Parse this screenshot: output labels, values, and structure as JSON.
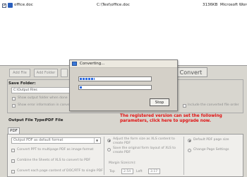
{
  "file_list": {
    "rows": [
      {
        "checked": true,
        "name": "office.doc",
        "path": "C:\\Test\\office.doc",
        "size": "3136KB",
        "type": "Microsoft Word"
      }
    ]
  },
  "toolbar": {
    "add_file": "Add File",
    "add_folder": "Add Folder",
    "convert": "Convert"
  },
  "save_folder": {
    "title": "Save Folder:",
    "path": "C:\\Output Files",
    "option_1": "Show output folder when done",
    "option_2": "Show error information in conversion",
    "include_order": "Include the converted file order"
  },
  "dialog": {
    "title": "Converting...",
    "progress_1": 0.21,
    "progress_2": 0.04,
    "stop_label": "Stop"
  },
  "registered_message": "The registered version can set the following parameters, click here to upgrade now.",
  "output": {
    "type_label": "Output File Type:",
    "type_value": "PDF File",
    "tab_label": "PDF",
    "format_value": "Output PDF as default format",
    "left_options": [
      "Convert PPT to multipage PDF as image format",
      "Combine the Sheets of XLS to convert to PDF",
      "Convert each page content of DOC/RTF to single PDF"
    ],
    "mid_options": [
      "Adjust the form size as XLS content to create PDF",
      "Save the original form layout of XLS to create PDF"
    ],
    "margin_label": "Margin Size(cm):",
    "top_label": "Top",
    "top_value": "2.54",
    "left_label": "Left",
    "left_value": "3.17",
    "right_options": [
      "Default PDF page size",
      "Change Page Settings"
    ]
  },
  "colors": {
    "accent": "#2d6be0",
    "warning": "#e01010"
  }
}
